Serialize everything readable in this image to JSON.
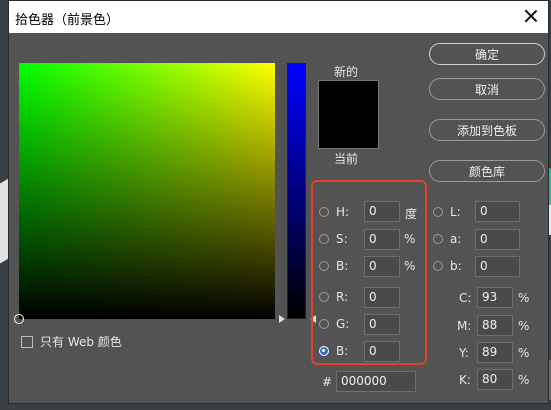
{
  "window": {
    "title": "拾色器（前景色）"
  },
  "swatch": {
    "new_label": "新的",
    "current_label": "当前",
    "color": "#000000"
  },
  "web_only": {
    "label": "只有 Web 颜色",
    "checked": false
  },
  "buttons": {
    "ok": "确定",
    "cancel": "取消",
    "add_swatch": "添加到色板",
    "libraries": "颜色库"
  },
  "hsb": {
    "h": {
      "label": "H:",
      "value": "0",
      "unit": "度"
    },
    "s": {
      "label": "S:",
      "value": "0",
      "unit": "%"
    },
    "b": {
      "label": "B:",
      "value": "0",
      "unit": "%"
    }
  },
  "rgb": {
    "r": {
      "label": "R:",
      "value": "0"
    },
    "g": {
      "label": "G:",
      "value": "0"
    },
    "b": {
      "label": "B:",
      "value": "0",
      "selected": true
    }
  },
  "lab": {
    "l": {
      "label": "L:",
      "value": "0"
    },
    "a": {
      "label": "a:",
      "value": "0"
    },
    "b": {
      "label": "b:",
      "value": "0"
    }
  },
  "cmyk": {
    "c": {
      "label": "C:",
      "value": "93",
      "unit": "%"
    },
    "m": {
      "label": "M:",
      "value": "88",
      "unit": "%"
    },
    "y": {
      "label": "Y:",
      "value": "89",
      "unit": "%"
    },
    "k": {
      "label": "K:",
      "value": "80",
      "unit": "%"
    }
  },
  "hex": {
    "label": "#",
    "value": "000000"
  },
  "highlight_color": "#e2442a"
}
